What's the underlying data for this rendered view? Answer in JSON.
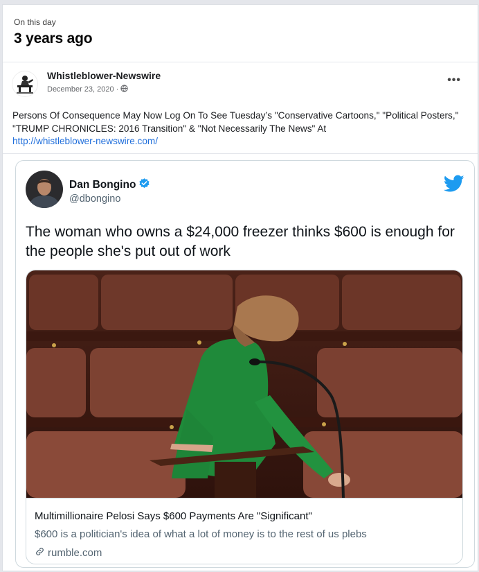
{
  "memory": {
    "subtitle": "On this day",
    "title": "3 years ago"
  },
  "post": {
    "page_name": "Whistleblower-Newswire",
    "date": "December 23, 2020",
    "date_separator": "·",
    "privacy_icon": "globe-icon",
    "more_label": "•••",
    "text": "Persons Of Consequence May Now Log On To See Tuesday’s \"Conservative Cartoons,\" \"Political Posters,\" \"TRUMP CHRONICLES: 2016 Transition\" & \"Not Necessarily The News\" At",
    "link": "http://whistleblower-newswire.com/"
  },
  "tweet": {
    "name": "Dan Bongino",
    "verified_icon": "verified-badge-icon",
    "handle": "@dbongino",
    "brand_icon": "twitter-bird-icon",
    "text": "The woman who owns a $24,000 freezer thinks $600 is enough for the people she's put out of work",
    "card": {
      "title": "Multimillionaire Pelosi Says $600 Payments Are \"Significant\"",
      "description": "$600 is a politician's idea of what a lot of money is to the rest of us plebs",
      "domain": "rumble.com",
      "link_icon": "link-icon"
    }
  },
  "colors": {
    "link": "#216fdb",
    "twitter_blue": "#1d9bf0",
    "muted": "#536471"
  }
}
